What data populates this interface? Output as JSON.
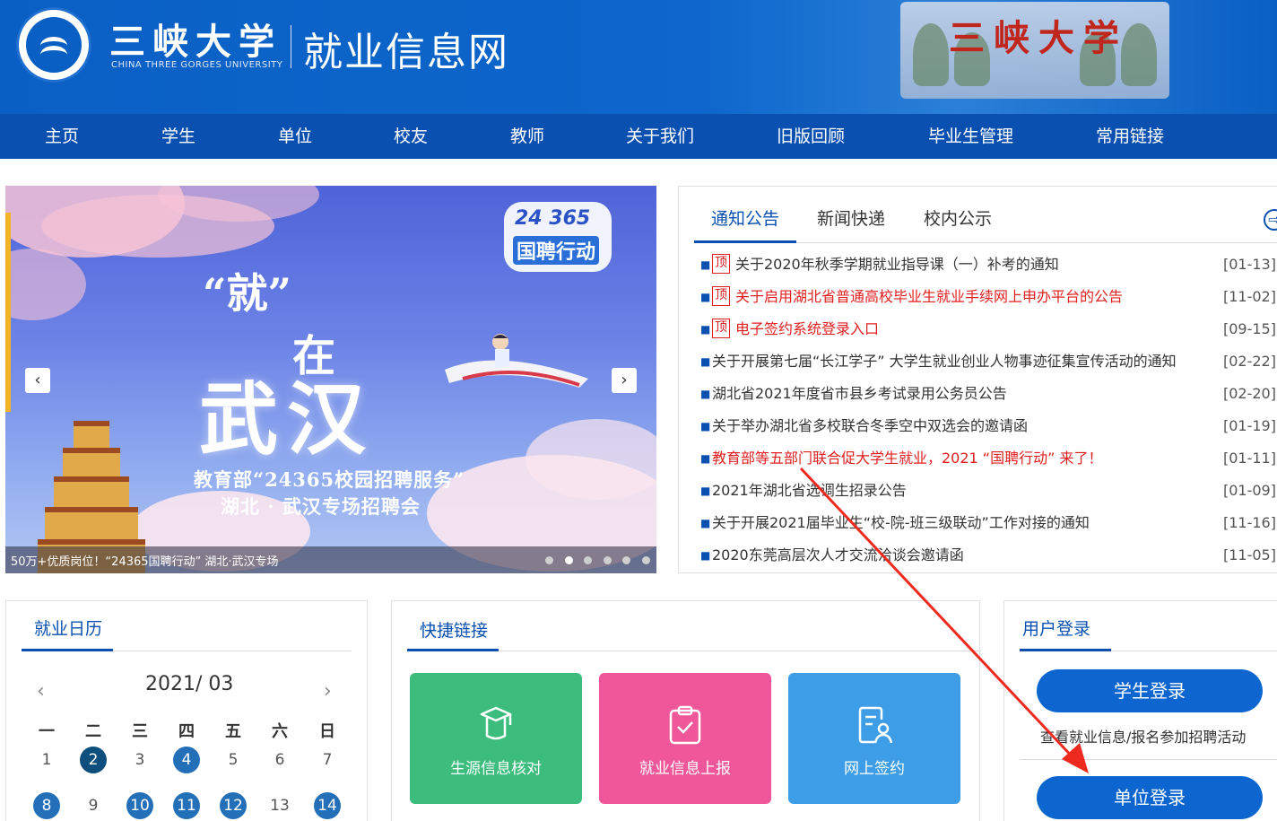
{
  "header": {
    "school_name_cn": "三峡大学",
    "school_name_en": "CHINA THREE GORGES UNIVERSITY",
    "site_title": "就业信息网",
    "gate_text": "三峡大学"
  },
  "nav": [
    "主页",
    "学生",
    "单位",
    "校友",
    "教师",
    "关于我们",
    "旧版回顾",
    "毕业生管理",
    "常用链接"
  ],
  "banner": {
    "quote": "“就”",
    "zai": "在",
    "wuhan": "武汉",
    "line1": "教育部“24365校园招聘服务”",
    "line2": "湖北 · 武汉专场招聘会",
    "badge_num": "24 365",
    "badge_text": "国聘行动",
    "caption": "50万+优质岗位！“24365国聘行动” 湖北·武汉专场",
    "prev": "‹",
    "next": "›",
    "slides": 6,
    "active_slide": 1
  },
  "news": {
    "tabs": [
      "通知公告",
      "新闻快递",
      "校内公示"
    ],
    "active_tab": 0,
    "more_icon": "⇨",
    "top_tag": "顶",
    "items": [
      {
        "title": "关于2020年秋季学期就业指导课（一）补考的通知",
        "date": "[01-13]",
        "top": true,
        "red": false
      },
      {
        "title": "关于启用湖北省普通高校毕业生就业手续网上申办平台的公告",
        "date": "[11-02]",
        "top": true,
        "red": true
      },
      {
        "title": "电子签约系统登录入口",
        "date": "[09-15]",
        "top": true,
        "red": true
      },
      {
        "title": "关于开展第七届“长江学子” 大学生就业创业人物事迹征集宣传活动的通知",
        "date": "[02-22]",
        "top": false,
        "red": false
      },
      {
        "title": "湖北省2021年度省市县乡考试录用公务员公告",
        "date": "[02-20]",
        "top": false,
        "red": false
      },
      {
        "title": "关于举办湖北省多校联合冬季空中双选会的邀请函",
        "date": "[01-19]",
        "top": false,
        "red": false
      },
      {
        "title": "教育部等五部门联合促大学生就业，2021 “国聘行动” 来了！",
        "date": "[01-11]",
        "top": false,
        "red": true
      },
      {
        "title": "2021年湖北省选调生招录公告",
        "date": "[01-09]",
        "top": false,
        "red": false
      },
      {
        "title": "关于开展2021届毕业生“校-院-班三级联动”工作对接的通知",
        "date": "[11-16]",
        "top": false,
        "red": false
      },
      {
        "title": "2020东莞高层次人才交流洽谈会邀请函",
        "date": "[11-05]",
        "top": false,
        "red": false
      }
    ]
  },
  "calendar": {
    "title": "就业日历",
    "month": "2021/ 03",
    "prev": "‹",
    "next": "›",
    "weekdays": [
      "一",
      "二",
      "三",
      "四",
      "五",
      "六",
      "日"
    ],
    "days": [
      {
        "d": "1",
        "mark": false,
        "today": false
      },
      {
        "d": "2",
        "mark": true,
        "today": true
      },
      {
        "d": "3",
        "mark": false,
        "today": false
      },
      {
        "d": "4",
        "mark": true,
        "today": false
      },
      {
        "d": "5",
        "mark": false,
        "today": false
      },
      {
        "d": "6",
        "mark": false,
        "today": false
      },
      {
        "d": "7",
        "mark": false,
        "today": false
      },
      {
        "d": "8",
        "mark": true,
        "today": false
      },
      {
        "d": "9",
        "mark": false,
        "today": false
      },
      {
        "d": "10",
        "mark": true,
        "today": false
      },
      {
        "d": "11",
        "mark": true,
        "today": false
      },
      {
        "d": "12",
        "mark": true,
        "today": false
      },
      {
        "d": "13",
        "mark": false,
        "today": false
      },
      {
        "d": "14",
        "mark": true,
        "today": false
      }
    ]
  },
  "quick_links": {
    "title": "快捷链接",
    "items": [
      {
        "label": "生源信息核对",
        "color": "#3dbd7d",
        "icon": "graduation-cap-icon"
      },
      {
        "label": "就业信息上报",
        "color": "#f0579a",
        "icon": "clipboard-check-icon"
      },
      {
        "label": "网上签约",
        "color": "#3d9de6",
        "icon": "contract-user-icon"
      }
    ]
  },
  "login": {
    "title": "用户登录",
    "student_button": "学生登录",
    "student_desc": "查看就业信息/报名参加招聘活动",
    "company_button": "单位登录"
  },
  "colors": {
    "brand_blue": "#0a50b0",
    "header_blue": "#0a5fc4",
    "alert_red": "#e02020",
    "annotation_red": "#ee2a1f"
  }
}
